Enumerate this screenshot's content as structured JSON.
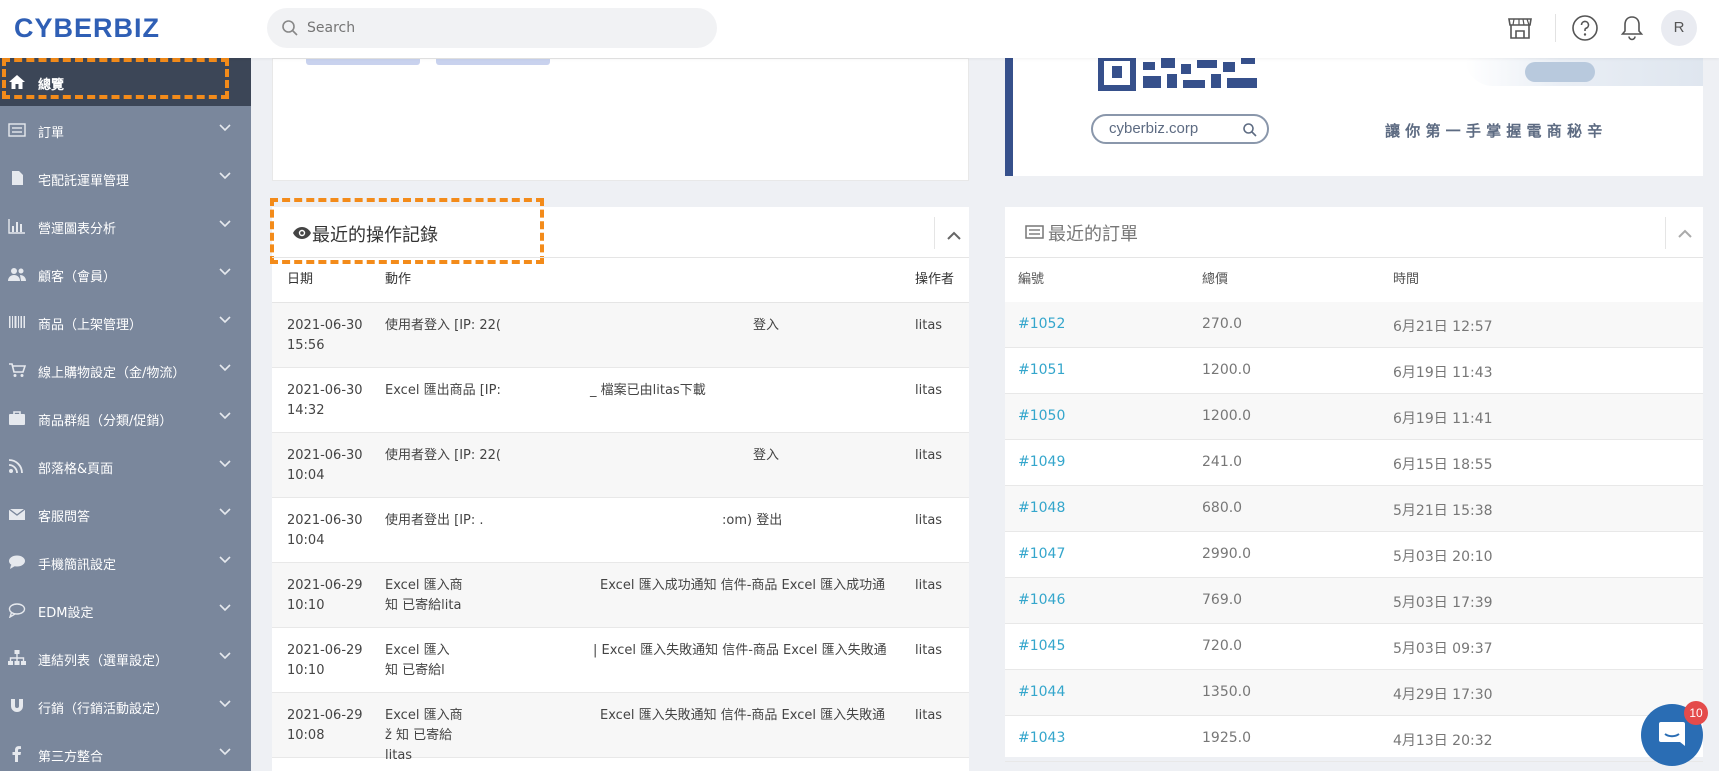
{
  "header": {
    "logo": "CYBERBIZ",
    "search_placeholder": "Search",
    "avatar_initial": "R"
  },
  "sidebar": {
    "items": [
      {
        "label": "總覽",
        "icon": "home-icon",
        "active": true
      },
      {
        "label": "訂單",
        "icon": "orders-icon"
      },
      {
        "label": "宅配託運單管理",
        "icon": "document-icon"
      },
      {
        "label": "營運圖表分析",
        "icon": "bar-chart-icon"
      },
      {
        "label": "顧客（會員）",
        "icon": "users-icon"
      },
      {
        "label": "商品（上架管理）",
        "icon": "barcode-icon"
      },
      {
        "label": "線上購物設定（金/物流）",
        "icon": "cart-icon"
      },
      {
        "label": "商品群組（分類/促銷）",
        "icon": "briefcase-icon"
      },
      {
        "label": "部落格&頁面",
        "icon": "rss-icon"
      },
      {
        "label": "客服問答",
        "icon": "envelope-icon"
      },
      {
        "label": "手機簡訊設定",
        "icon": "chat-bubble-icon"
      },
      {
        "label": "EDM設定",
        "icon": "chat-outline-icon"
      },
      {
        "label": "連結列表（選單設定）",
        "icon": "sitemap-icon"
      },
      {
        "label": "行銷（行銷活動設定）",
        "icon": "magnet-icon"
      },
      {
        "label": "第三方整合",
        "icon": "facebook-icon"
      }
    ]
  },
  "banner": {
    "handle": "cyberbiz.corp",
    "slogan": "讓 你 第 一 手 掌 握 電 商 秘 辛"
  },
  "activity": {
    "title": "最近的操作記錄",
    "columns": [
      "日期",
      "動作",
      "操作者"
    ],
    "rows": [
      {
        "date": "2021-06-30 15:56",
        "action": "使用者登入 [IP: 22(",
        "action_tail": "登入",
        "user": "litas"
      },
      {
        "date": "2021-06-30 14:32",
        "action": "Excel 匯出商品 [IP:",
        "action_tail": "_ 檔案已由litas下載",
        "user": "litas"
      },
      {
        "date": "2021-06-30 10:04",
        "action": "使用者登入 [IP: 22(",
        "action_tail": "登入",
        "user": "litas"
      },
      {
        "date": "2021-06-30 10:04",
        "action": "使用者登出 [IP: .",
        "action_tail": ":om) 登出",
        "user": "litas"
      },
      {
        "date": "2021-06-29 10:10",
        "action": "Excel 匯入商 知 已寄給lita",
        "action_tail": "Excel 匯入成功通知 信件-商品 Excel 匯入成功通",
        "user": "litas"
      },
      {
        "date": "2021-06-29 10:10",
        "action": "Excel 匯入 知 已寄給l",
        "action_tail": "| Excel 匯入失敗通知 信件-商品 Excel 匯入失敗通",
        "user": "litas"
      },
      {
        "date": "2021-06-29 10:08",
        "action": "Excel 匯入商ž 知 已寄給litas",
        "action_tail": "Excel 匯入失敗通知 信件-商品 Excel 匯入失敗通",
        "user": "litas"
      }
    ]
  },
  "orders": {
    "title": "最近的訂單",
    "columns": [
      "編號",
      "總價",
      "時間"
    ],
    "rows": [
      {
        "id": "#1052",
        "total": "270.0",
        "time": "6月21日 12:57"
      },
      {
        "id": "#1051",
        "total": "1200.0",
        "time": "6月19日 11:43"
      },
      {
        "id": "#1050",
        "total": "1200.0",
        "time": "6月19日 11:41"
      },
      {
        "id": "#1049",
        "total": "241.0",
        "time": "6月15日 18:55"
      },
      {
        "id": "#1048",
        "total": "680.0",
        "time": "5月21日 15:38"
      },
      {
        "id": "#1047",
        "total": "2990.0",
        "time": "5月03日 20:10"
      },
      {
        "id": "#1046",
        "total": "769.0",
        "time": "5月03日 17:39"
      },
      {
        "id": "#1045",
        "total": "720.0",
        "time": "5月03日 09:37"
      },
      {
        "id": "#1044",
        "total": "1350.0",
        "time": "4月29日 17:30"
      },
      {
        "id": "#1043",
        "total": "1925.0",
        "time": "4月13日 20:32"
      }
    ]
  },
  "chat": {
    "badge_count": "10"
  },
  "colors": {
    "accent": "#34a6cc",
    "sidebar": "#7a879c",
    "sidebar_active": "#3c4657",
    "highlight": "#f38b1a",
    "brand": "#2f5fb5"
  }
}
